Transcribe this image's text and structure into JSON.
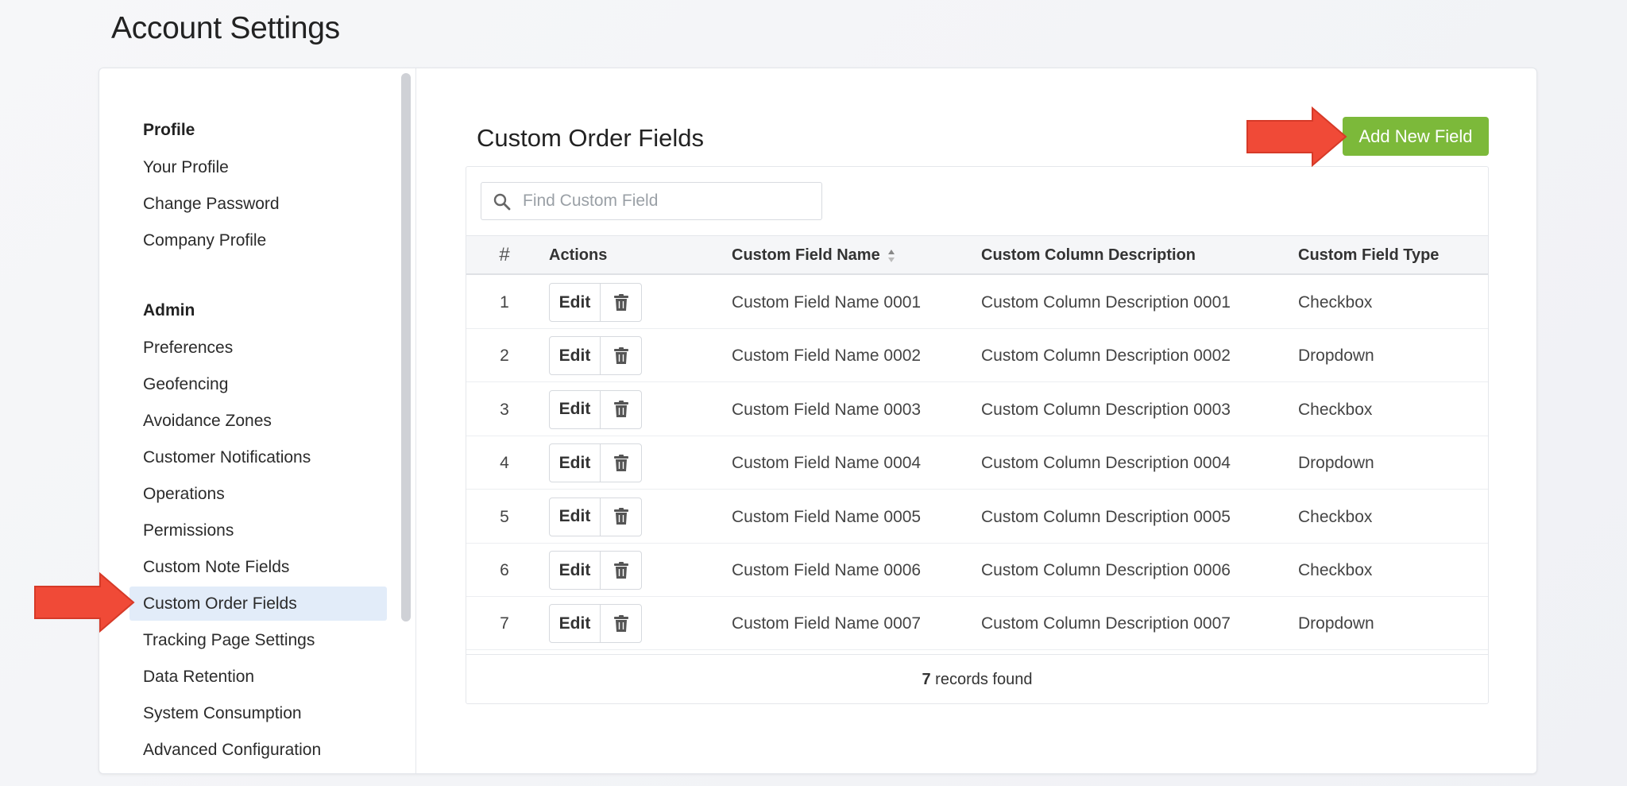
{
  "page_title": "Account Settings",
  "sidebar": {
    "groups": [
      {
        "heading": "Profile",
        "items": [
          "Your Profile",
          "Change Password",
          "Company Profile"
        ]
      },
      {
        "heading": "Admin",
        "items": [
          "Preferences",
          "Geofencing",
          "Avoidance Zones",
          "Customer Notifications",
          "Operations",
          "Permissions",
          "Custom Note Fields",
          "Custom Order Fields",
          "Tracking Page Settings",
          "Data Retention",
          "System Consumption",
          "Advanced Configuration"
        ]
      }
    ],
    "active_item": "Custom Order Fields"
  },
  "main": {
    "title": "Custom Order Fields",
    "add_button": "Add New Field",
    "search_placeholder": "Find Custom Field",
    "columns": [
      "#",
      "Actions",
      "Custom Field Name",
      "Custom Column Description",
      "Custom Field Type"
    ],
    "edit_label": "Edit",
    "rows": [
      {
        "num": "1",
        "name": "Custom Field Name 0001",
        "description": "Custom Column Description 0001",
        "type": "Checkbox"
      },
      {
        "num": "2",
        "name": "Custom Field Name 0002",
        "description": "Custom Column Description 0002",
        "type": "Dropdown"
      },
      {
        "num": "3",
        "name": "Custom Field Name 0003",
        "description": "Custom Column Description 0003",
        "type": "Checkbox"
      },
      {
        "num": "4",
        "name": "Custom Field Name 0004",
        "description": "Custom Column Description 0004",
        "type": "Dropdown"
      },
      {
        "num": "5",
        "name": "Custom Field Name 0005",
        "description": "Custom Column Description 0005",
        "type": "Checkbox"
      },
      {
        "num": "6",
        "name": "Custom Field Name 0006",
        "description": "Custom Column Description 0006",
        "type": "Checkbox"
      },
      {
        "num": "7",
        "name": "Custom Field Name 0007",
        "description": "Custom Column Description 0007",
        "type": "Dropdown"
      }
    ],
    "records_count": "7",
    "records_suffix": " records found"
  },
  "colors": {
    "accent_green": "#7cb93a",
    "active_bg": "#e2ecf9",
    "annotation_arrow": "#f04a37"
  },
  "icons": {
    "search": "search-icon",
    "delete": "trash-icon",
    "sort": "sort-icon",
    "annotation": "arrow-right-icon"
  }
}
